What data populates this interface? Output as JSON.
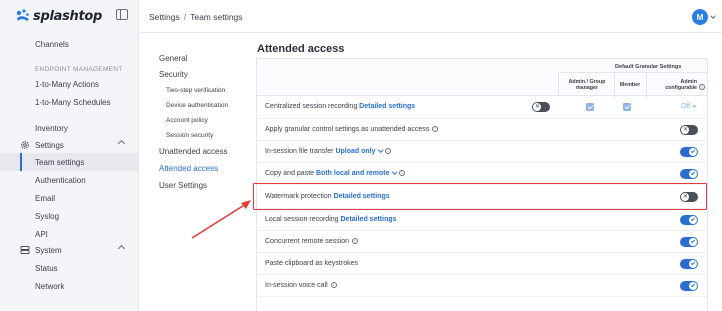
{
  "app": {
    "logo_text": "splashtop",
    "brand_color": "#2a6ecf",
    "user_initial": "M"
  },
  "breadcrumb": {
    "root": "Settings",
    "separator": "/",
    "current": "Team settings"
  },
  "sidebar": {
    "items": [
      {
        "label": "Channels"
      },
      {
        "label": "ENDPOINT MANAGEMENT"
      },
      {
        "label": "1-to-Many Actions"
      },
      {
        "label": "1-to-Many Schedules"
      },
      {
        "label": "Inventory"
      },
      {
        "label": "Settings",
        "icon": "gear-icon"
      },
      {
        "label": "Team settings"
      },
      {
        "label": "Authentication"
      },
      {
        "label": "Email"
      },
      {
        "label": "Syslog"
      },
      {
        "label": "API"
      },
      {
        "label": "System",
        "icon": "system-icon"
      },
      {
        "label": "Status"
      },
      {
        "label": "Network"
      }
    ]
  },
  "subnav": {
    "items": [
      {
        "label": "General"
      },
      {
        "label": "Security"
      },
      {
        "label": "Two-step verification"
      },
      {
        "label": "Device authentication"
      },
      {
        "label": "Account policy"
      },
      {
        "label": "Session security"
      },
      {
        "label": "Unattended access"
      },
      {
        "label": "Attended access"
      },
      {
        "label": "User Settings"
      }
    ]
  },
  "main": {
    "title": "Attended access",
    "header": {
      "group_title": "Default Granular Settings",
      "col_admin_line1": "Admin / Group",
      "col_admin_line2": "manager",
      "col_member": "Member",
      "col_admin_conf_line1": "Admin",
      "col_admin_conf_line2": "configurable"
    },
    "rows": [
      {
        "label": "Centralized session recording",
        "link": "Detailed settings",
        "toggle": "off",
        "admin_checked": true,
        "member_checked": true,
        "configurable": "Off"
      },
      {
        "label": "Apply granular control settings as unattended access",
        "info": true,
        "toggle": "off"
      },
      {
        "label": "In-session file transfer",
        "link": "Upload only",
        "dropdown": true,
        "info": true,
        "toggle": "on"
      },
      {
        "label": "Copy and paste",
        "link": "Both local and remote",
        "dropdown": true,
        "info": true,
        "toggle": "on"
      },
      {
        "label": "Watermark protection",
        "link": "Detailed settings",
        "toggle": "off"
      },
      {
        "label": "Local session recording",
        "link": "Detailed settings",
        "toggle": "on"
      },
      {
        "label": "Concurrent remote session",
        "info": true,
        "toggle": "on"
      },
      {
        "label": "Paste clipboard as keystrokes",
        "toggle": "on"
      },
      {
        "label": "In-session voice call",
        "info": true,
        "toggle": "on"
      }
    ]
  },
  "annotation": {
    "highlight_color": "#e03a3a"
  }
}
